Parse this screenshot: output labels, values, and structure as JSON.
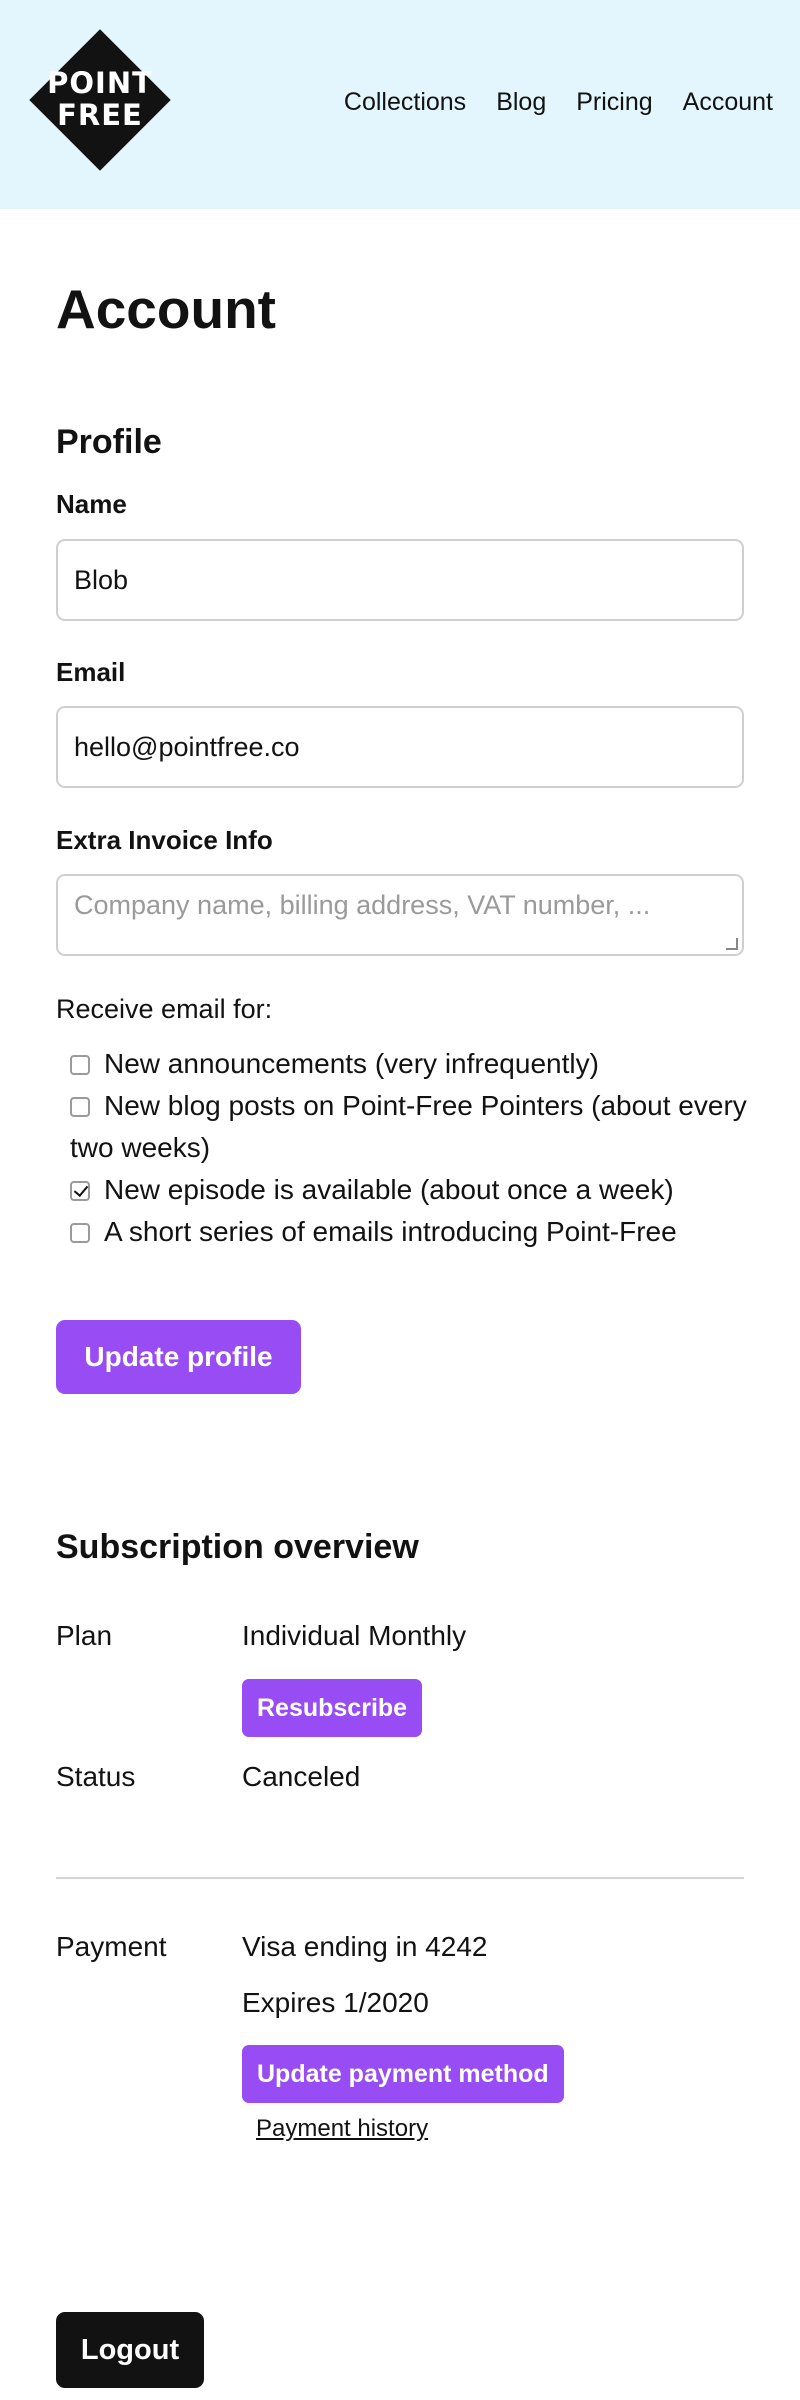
{
  "brand": {
    "logo_line1": "POINT",
    "logo_line2": "FREE",
    "bg": "#e4f6fd"
  },
  "nav": {
    "items": [
      "Collections",
      "Blog",
      "Pricing",
      "Account"
    ]
  },
  "page": {
    "title": "Account"
  },
  "profile": {
    "heading": "Profile",
    "name_label": "Name",
    "name_value": "Blob",
    "email_label": "Email",
    "email_value": "hello@pointfree.co",
    "invoice_label": "Extra Invoice Info",
    "invoice_placeholder": "Company name, billing address, VAT number, ...",
    "receive_label": "Receive email for:",
    "email_options": [
      {
        "label": "New announcements (very infrequently)",
        "checked": false
      },
      {
        "label": "New blog posts on Point-Free Pointers (about every two weeks)",
        "checked": false
      },
      {
        "label": "New episode is available (about once a week)",
        "checked": true
      },
      {
        "label": "A short series of emails introducing Point-Free",
        "checked": false
      }
    ],
    "update_button": "Update profile"
  },
  "subscription": {
    "heading": "Subscription overview",
    "plan_label": "Plan",
    "plan_value": "Individual Monthly",
    "resubscribe_button": "Resubscribe",
    "status_label": "Status",
    "status_value": "Canceled",
    "payment_label": "Payment",
    "card_value": "Visa ending in 4242",
    "expires_value": "Expires 1/2020",
    "update_payment_button": "Update payment method",
    "payment_history_link": "Payment history"
  },
  "logout_button": "Logout",
  "colors": {
    "accent": "#974df3",
    "dark": "#121212"
  }
}
